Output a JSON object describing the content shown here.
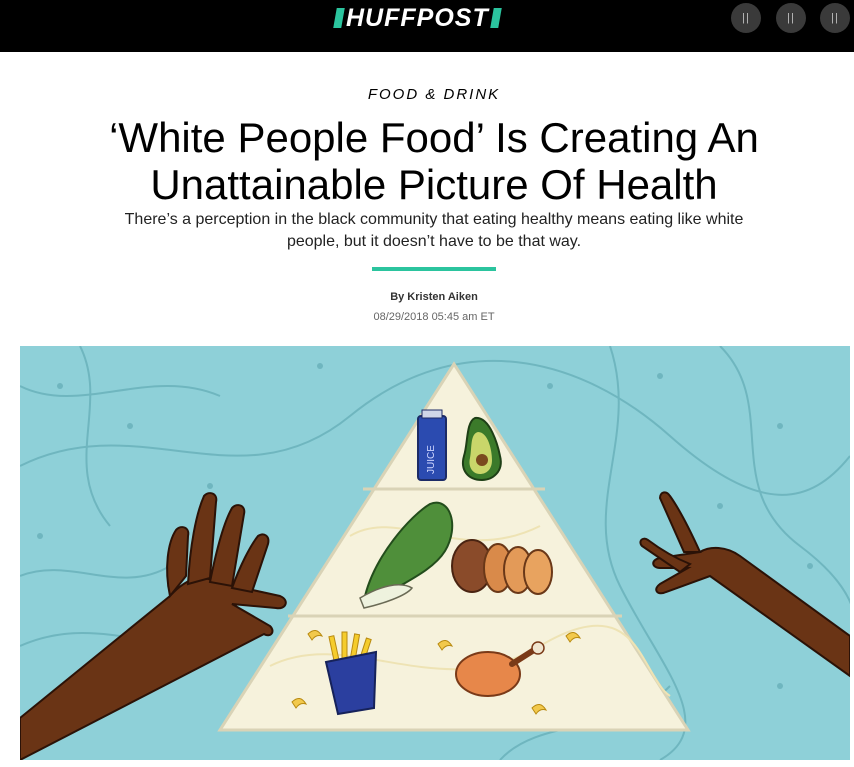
{
  "header": {
    "logo_text": "HUFFPOST",
    "brand_color": "#2bc49e",
    "buttons": [
      {
        "label": "||",
        "icon": "menu-icon"
      },
      {
        "label": "||",
        "icon": "menu-icon"
      },
      {
        "label": "||",
        "icon": "menu-icon"
      }
    ]
  },
  "article": {
    "category": "FOOD & DRINK",
    "headline": "‘White People Food’ Is Creating An Unattainable Picture Of Health",
    "dek": "There’s a perception in the black community that eating healthy means eating like white people, but it doesn’t have to be that way.",
    "byline": "By Kristen Aiken",
    "timestamp": "08/29/2018 05:45 am ET"
  },
  "hero": {
    "background_color": "#8ed0d8",
    "juice_label": "JUICE"
  }
}
